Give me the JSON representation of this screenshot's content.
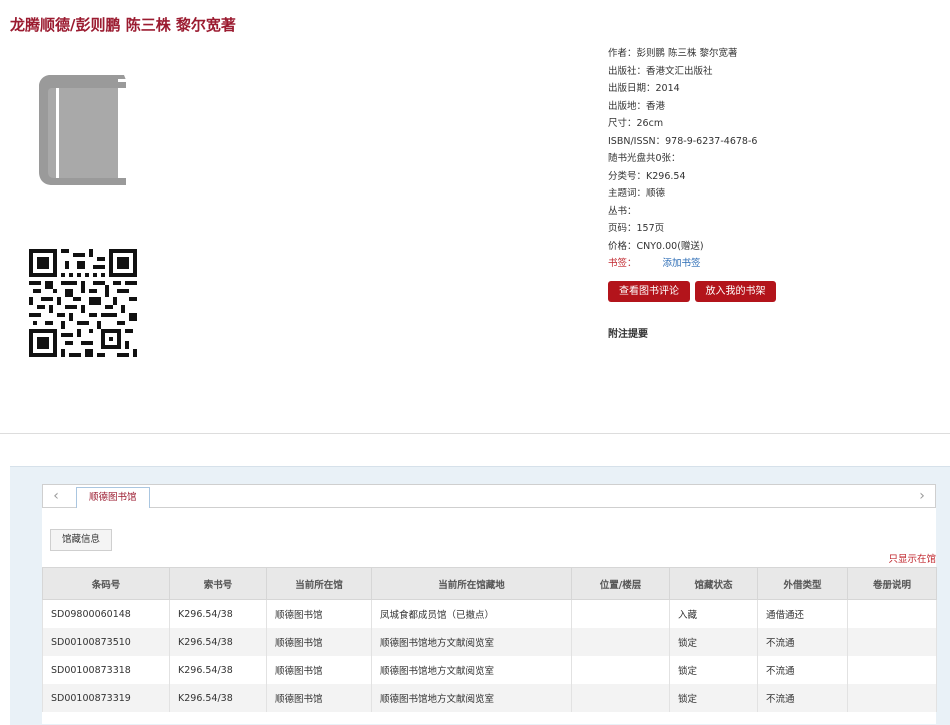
{
  "book": {
    "title": "龙腾顺德/彭则鹏 陈三株 黎尔宽著"
  },
  "details": [
    {
      "label": "作者：",
      "value": "彭则鹏 陈三株 黎尔宽著"
    },
    {
      "label": "出版社：",
      "value": "香港文汇出版社"
    },
    {
      "label": "出版日期：",
      "value": "2014"
    },
    {
      "label": "出版地：",
      "value": "香港"
    },
    {
      "label": "尺寸：",
      "value": "26cm"
    },
    {
      "label": "ISBN/ISSN：",
      "value": "978-9-6237-4678-6"
    },
    {
      "label": "随书光盘共0张：",
      "value": ""
    },
    {
      "label": "分类号：",
      "value": "K296.54"
    },
    {
      "label": "主题词：",
      "value": "顺德"
    },
    {
      "label": "丛书：",
      "value": ""
    },
    {
      "label": "页码：",
      "value": "157页"
    },
    {
      "label": "价格：",
      "value": "CNY0.00(赠送)"
    }
  ],
  "bookmark": {
    "label": "书签：",
    "add_label": "添加书签"
  },
  "buttons": {
    "view_reviews": "查看图书评论",
    "add_shelf": "放入我的书架"
  },
  "notes_heading": "附注提要",
  "library_tab": "顺德图书馆",
  "holdings_tab": "馆藏信息",
  "only_this_library": "只显示在馆",
  "colors": {
    "brand": "#9b1b30",
    "button": "#b3141b",
    "link": "#2a6bb5"
  },
  "table": {
    "headers": [
      "条码号",
      "索书号",
      "当前所在馆",
      "当前所在馆藏地",
      "位置/楼层",
      "馆藏状态",
      "外借类型",
      "卷册说明"
    ],
    "rows": [
      [
        "SD09800060148",
        "K296.54/38",
        "顺德图书馆",
        "凤城食都成员馆（已撤点）",
        "",
        "入藏",
        "通借通还",
        ""
      ],
      [
        "SD00100873510",
        "K296.54/38",
        "顺德图书馆",
        "顺德图书馆地方文献阅览室",
        "",
        "锁定",
        "不流通",
        ""
      ],
      [
        "SD00100873318",
        "K296.54/38",
        "顺德图书馆",
        "顺德图书馆地方文献阅览室",
        "",
        "锁定",
        "不流通",
        ""
      ],
      [
        "SD00100873319",
        "K296.54/38",
        "顺德图书馆",
        "顺德图书馆地方文献阅览室",
        "",
        "锁定",
        "不流通",
        ""
      ]
    ]
  }
}
